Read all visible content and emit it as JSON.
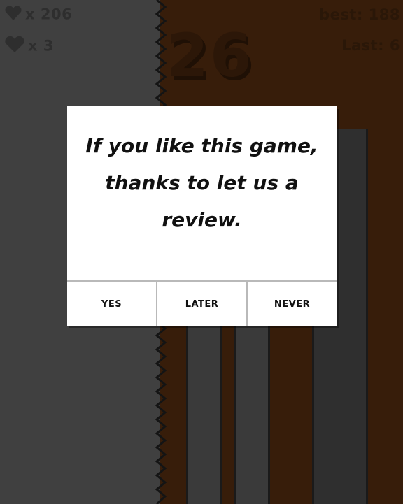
{
  "hud": {
    "gems_label": "x 206",
    "lives_label": "x 3",
    "best_label": "best: 188",
    "last_label": "Last: 6"
  },
  "score": "26",
  "dialog": {
    "message": "If you like this game, thanks to let us a review.",
    "buttons": {
      "yes": "YES",
      "later": "LATER",
      "never": "NEVER"
    }
  },
  "colors": {
    "left_background": "#404040",
    "right_background": "#371d0a",
    "dialog_background": "#ffffff"
  },
  "icons": [
    "heart-icon",
    "heart-icon"
  ]
}
